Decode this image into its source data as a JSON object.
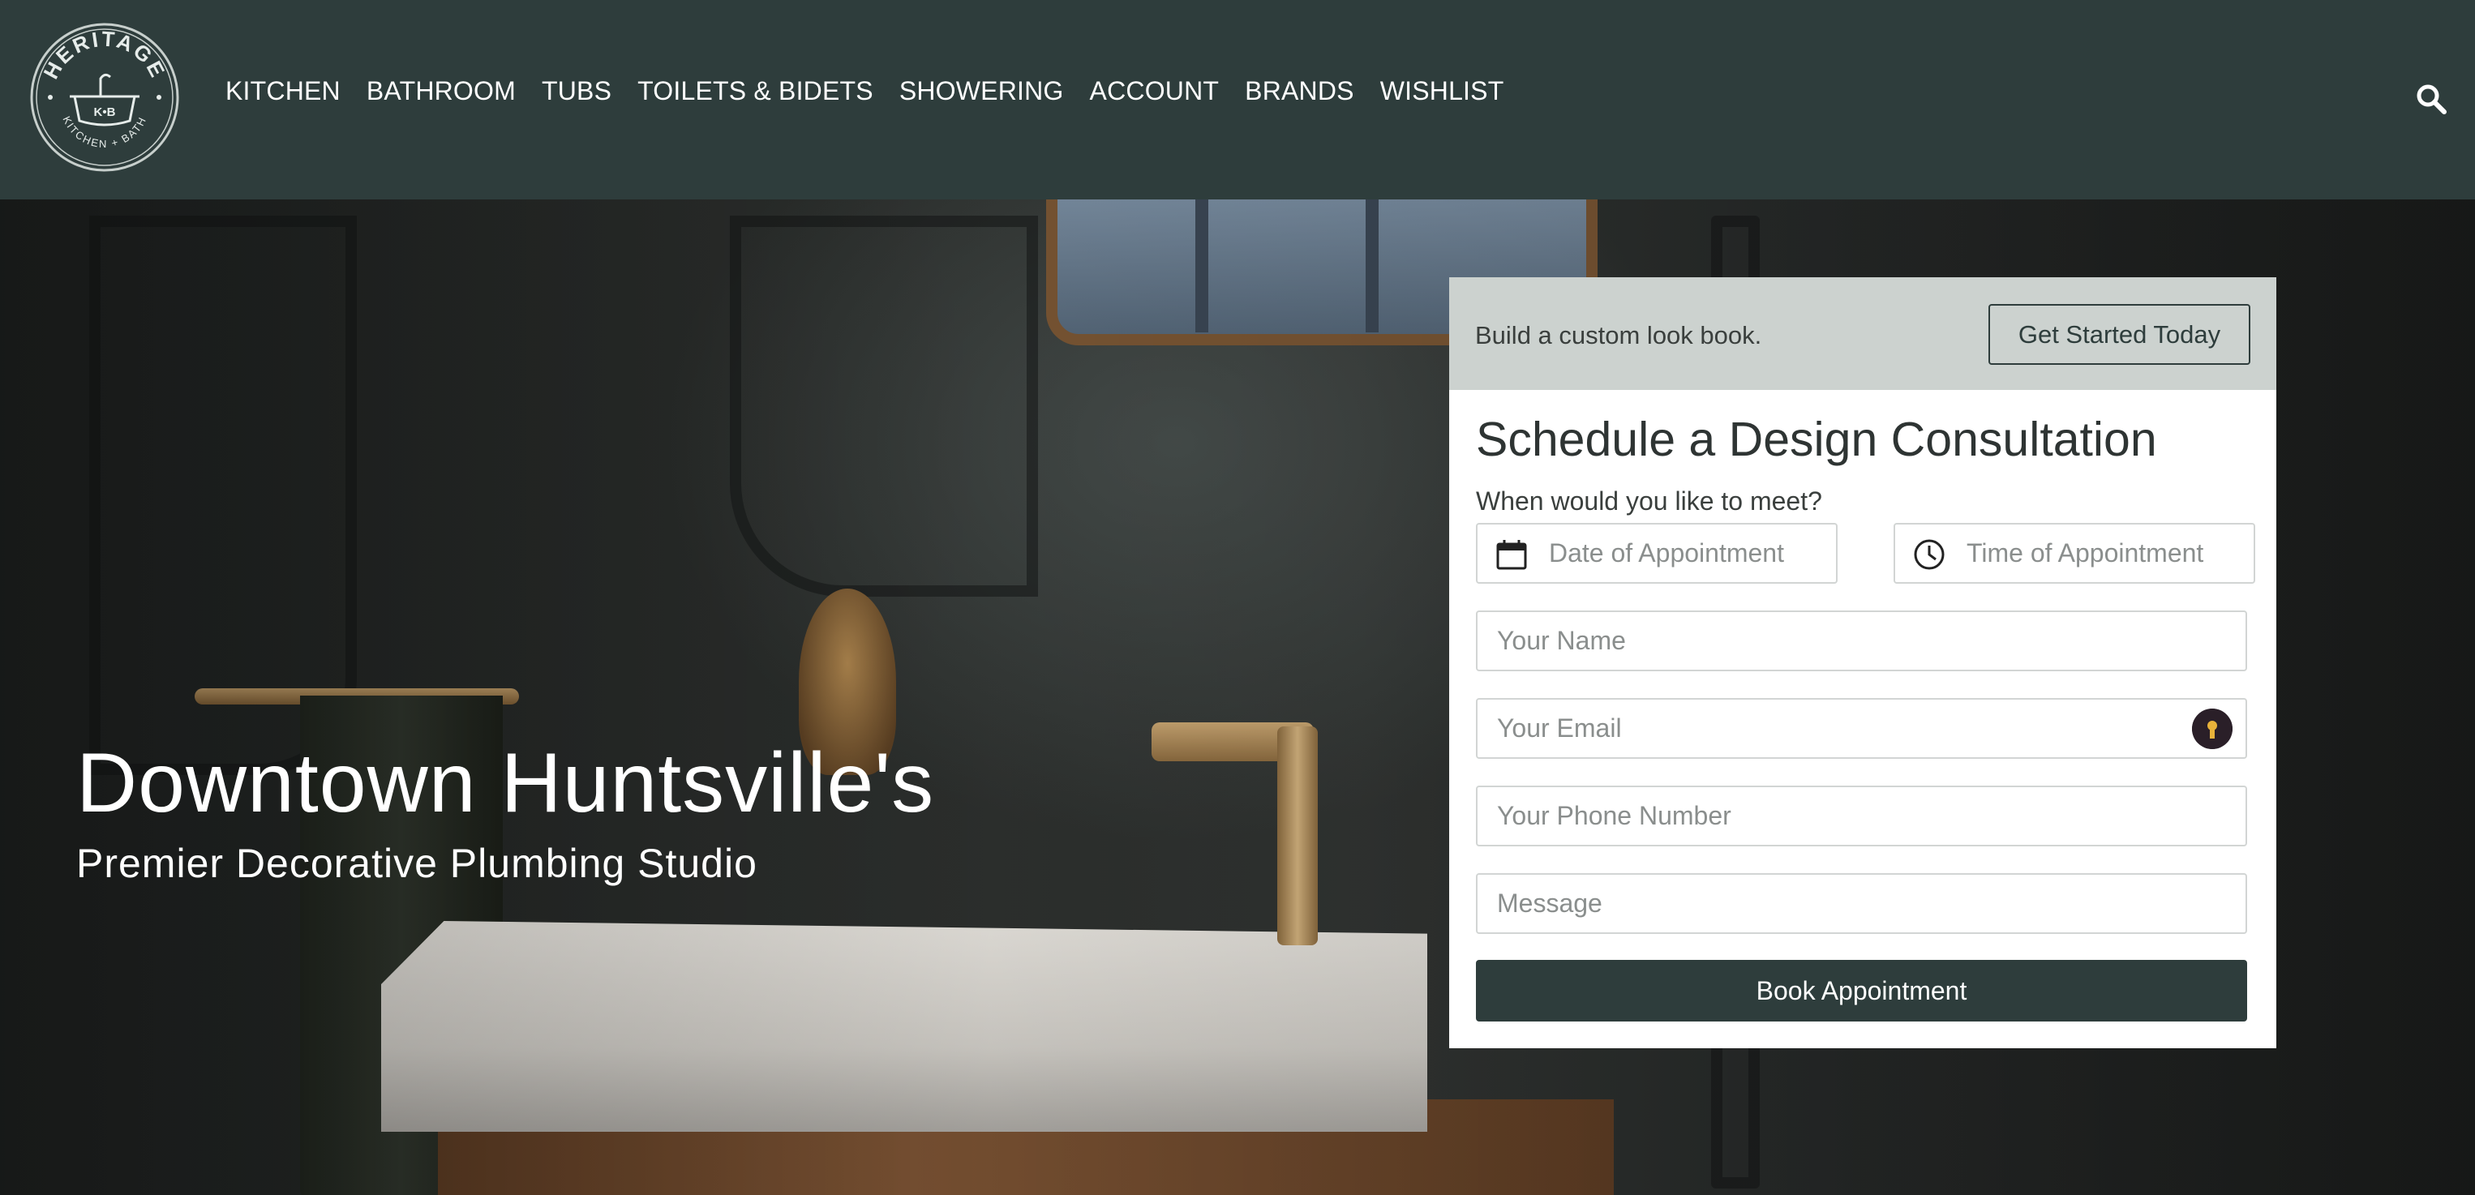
{
  "brand": {
    "name": "HERITAGE",
    "initials": "K•B",
    "tagline": "KITCHEN + BATH"
  },
  "nav": {
    "items": [
      {
        "label": "KITCHEN"
      },
      {
        "label": "BATHROOM"
      },
      {
        "label": "TUBS"
      },
      {
        "label": "TOILETS & BIDETS"
      },
      {
        "label": "SHOWERING"
      },
      {
        "label": "ACCOUNT"
      },
      {
        "label": "BRANDS"
      },
      {
        "label": "WISHLIST"
      }
    ],
    "search_icon": "search-icon"
  },
  "hero": {
    "title": "Downtown Huntsville's",
    "subtitle": "Premier Decorative Plumbing Studio"
  },
  "form": {
    "promo_text": "Build a custom look book.",
    "promo_button": "Get Started Today",
    "title": "Schedule a Design Consultation",
    "question": "When would you like to meet?",
    "date_placeholder": "Date of Appointment",
    "time_placeholder": "Time of Appointment",
    "name_placeholder": "Your Name",
    "email_placeholder": "Your Email",
    "phone_placeholder": "Your Phone Number",
    "message_placeholder": "Message",
    "submit_label": "Book Appointment"
  },
  "colors": {
    "header_bg": "#2e3d3c",
    "card_top_bg": "#ccd2cf",
    "button_bg": "#2e3d3c",
    "password_badge": "#2a1f28",
    "password_badge_key": "#e8b23a"
  }
}
